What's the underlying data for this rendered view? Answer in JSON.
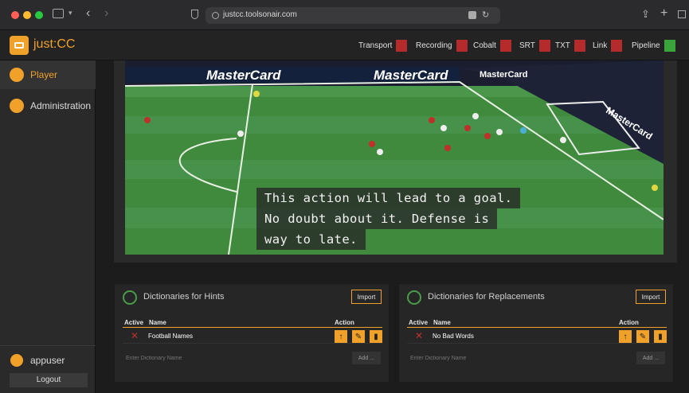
{
  "browser": {
    "url": "justcc.toolsonair.com"
  },
  "app": {
    "brand": "just:CC"
  },
  "status": [
    {
      "label": "Transport",
      "color": "#b52a2a"
    },
    {
      "label": "Recording",
      "color": "#b52a2a"
    },
    {
      "label": "Cobalt",
      "color": "#b52a2a"
    },
    {
      "label": "SRT",
      "color": "#b52a2a"
    },
    {
      "label": "TXT",
      "color": "#b52a2a"
    },
    {
      "label": "Link",
      "color": "#b52a2a"
    },
    {
      "label": "Pipeline",
      "color": "#3aa53a"
    }
  ],
  "sidebar": {
    "items": [
      {
        "label": "Player"
      },
      {
        "label": "Administration"
      }
    ],
    "user": "appuser",
    "logout": "Logout"
  },
  "video": {
    "ads": [
      "MasterCard",
      "MasterCard",
      "MasterCard",
      "MasterCard"
    ],
    "caption": [
      "This action will lead to a goal.",
      "No doubt about it. Defense is",
      "way to late."
    ]
  },
  "hints": {
    "title": "Dictionaries for Hints",
    "import": "Import",
    "col_active": "Active",
    "col_name": "Name",
    "col_action": "Action",
    "rows": [
      {
        "name": "Football Names"
      }
    ],
    "placeholder": "Enter Dictionary Name",
    "add": "Add ..."
  },
  "replacements": {
    "title": "Dictionaries for Replacements",
    "import": "Import",
    "col_active": "Active",
    "col_name": "Name",
    "col_action": "Action",
    "rows": [
      {
        "name": "No Bad Words"
      }
    ],
    "placeholder": "Enter Dictionary Name",
    "add": "Add ..."
  }
}
